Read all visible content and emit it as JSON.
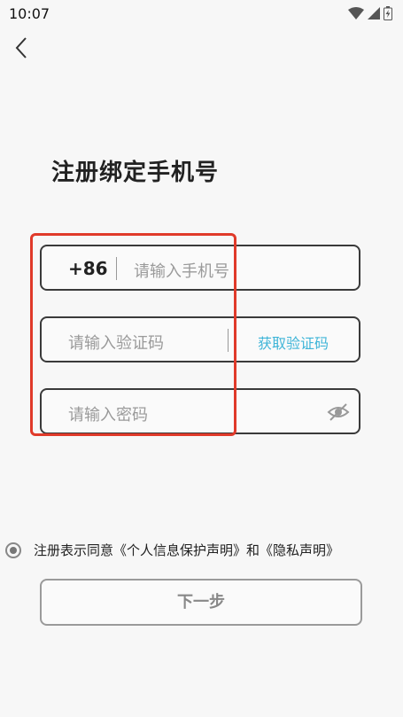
{
  "status_bar": {
    "time": "10:07",
    "icons": [
      "wifi-icon",
      "signal-icon",
      "battery-charging-icon"
    ]
  },
  "nav": {
    "back_icon": "chevron-left-icon"
  },
  "page": {
    "title": "注册绑定手机号"
  },
  "form": {
    "phone": {
      "country_code": "+86",
      "placeholder": "请输入手机号",
      "value": ""
    },
    "code": {
      "placeholder": "请输入验证码",
      "value": "",
      "get_code_label": "获取验证码"
    },
    "password": {
      "placeholder": "请输入密码",
      "value": "",
      "toggle_icon": "eye-off-icon"
    }
  },
  "agreement": {
    "selected": true,
    "text": "注册表示同意《个人信息保护声明》和《隐私声明》"
  },
  "next_button": {
    "label": "下一步"
  },
  "colors": {
    "accent": "#3fb5d8",
    "highlight": "#e03a2a",
    "border": "#3a3a3a",
    "placeholder": "#9a9a9a"
  }
}
